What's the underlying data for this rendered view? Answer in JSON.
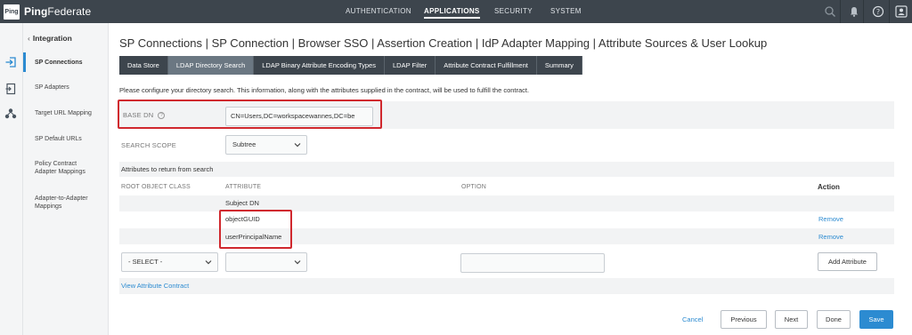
{
  "app": {
    "badge": "Ping",
    "name_bold": "Ping",
    "name_rest": "Federate"
  },
  "topnav": [
    {
      "label": "AUTHENTICATION",
      "active": false
    },
    {
      "label": "APPLICATIONS",
      "active": true
    },
    {
      "label": "SECURITY",
      "active": false
    },
    {
      "label": "SYSTEM",
      "active": false
    }
  ],
  "top_icons": [
    "search-icon",
    "bell-icon",
    "help-icon",
    "user-icon"
  ],
  "rail_icons": [
    "sign-in-icon",
    "document-icon",
    "cluster-icon"
  ],
  "sidebar": {
    "back_label": "Integration",
    "items": [
      {
        "label": "SP Connections",
        "active": true
      },
      {
        "label": "SP Adapters",
        "active": false
      },
      {
        "label": "Target URL Mapping",
        "active": false
      },
      {
        "label": "SP Default URLs",
        "active": false
      },
      {
        "label": "Policy Contract Adapter Mappings",
        "active": false
      },
      {
        "label": "Adapter-to-Adapter Mappings",
        "active": false
      }
    ]
  },
  "page": {
    "title": "SP Connections | SP Connection | Browser SSO | Assertion Creation | IdP Adapter Mapping | Attribute Sources & User Lookup",
    "tabs": [
      {
        "label": "Data Store",
        "active": false
      },
      {
        "label": "LDAP Directory Search",
        "active": true
      },
      {
        "label": "LDAP Binary Attribute Encoding Types",
        "active": false
      },
      {
        "label": "LDAP Filter",
        "active": false
      },
      {
        "label": "Attribute Contract Fulfillment",
        "active": false
      },
      {
        "label": "Summary",
        "active": false
      }
    ],
    "description": "Please configure your directory search. This information, along with the attributes supplied in the contract, will be used to fulfill the contract."
  },
  "form": {
    "base_dn_label": "BASE DN",
    "base_dn_value": "CN=Users,DC=workspacewannes,DC=be",
    "search_scope_label": "SEARCH SCOPE",
    "search_scope_value": "Subtree"
  },
  "attributes": {
    "section_title": "Attributes to return from search",
    "columns": {
      "root_object_class": "ROOT OBJECT CLASS",
      "attribute": "ATTRIBUTE",
      "option": "OPTION",
      "action": "Action"
    },
    "rows": [
      {
        "attribute": "Subject DN",
        "action": ""
      },
      {
        "attribute": "objectGUID",
        "action": "Remove"
      },
      {
        "attribute": "userPrincipalName",
        "action": "Remove"
      }
    ],
    "new_row": {
      "root_object_class": "- SELECT -",
      "attribute": "",
      "option": "",
      "add_button": "Add Attribute"
    },
    "view_contract_link": "View Attribute Contract"
  },
  "footer": {
    "cancel": "Cancel",
    "previous": "Previous",
    "next": "Next",
    "done": "Done",
    "save": "Save"
  },
  "colors": {
    "topbar": "#3d454d",
    "accent": "#2c8bd1",
    "highlight": "#d0282e"
  }
}
